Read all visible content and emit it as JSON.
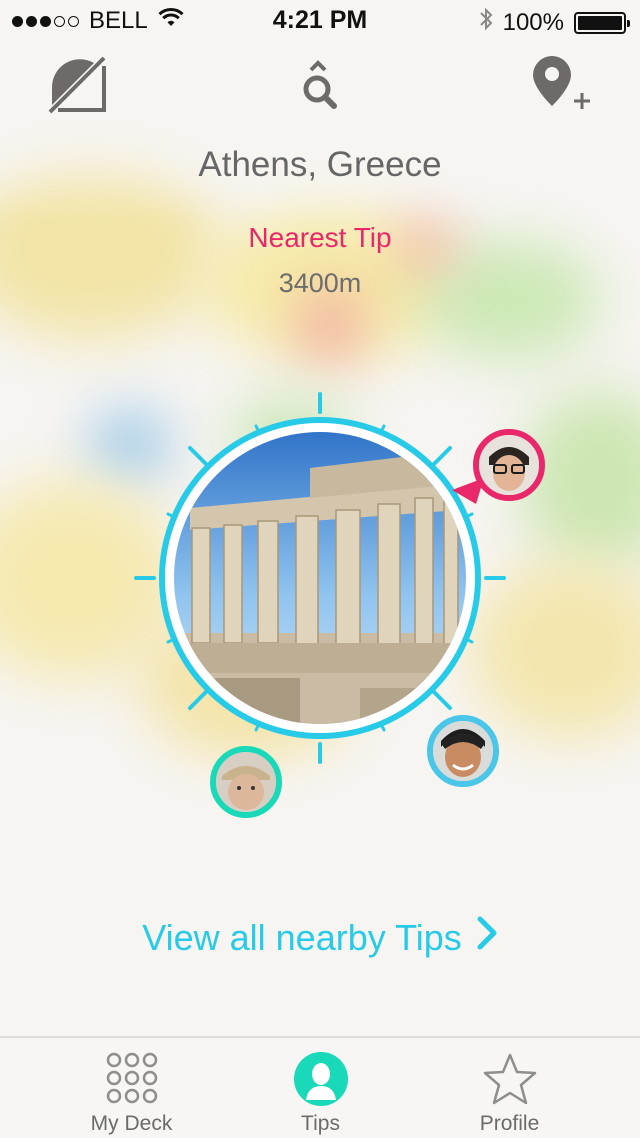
{
  "status_bar": {
    "signal_filled": 3,
    "signal_empty": 2,
    "carrier": "BELL",
    "time": "4:21 PM",
    "battery_percent": "100%",
    "battery_level": 1.0
  },
  "toolbar": {
    "left_icon": "compass-toggle-icon",
    "center_icon": "search-icon",
    "right_icon": "add-location-icon"
  },
  "location": {
    "city": "Athens, Greece"
  },
  "nearest_tip": {
    "label": "Nearest Tip",
    "distance": "3400m"
  },
  "radar": {
    "center_image": "Parthenon photo",
    "colors": {
      "ring": "#27cbe8",
      "pink": "#e8286a",
      "teal": "#1ad9b8",
      "blue": "#4ac6e8"
    },
    "avatars": [
      {
        "name": "avatar-user-glasses",
        "ring_color": "#e8286a"
      },
      {
        "name": "avatar-user-smiling",
        "ring_color": "#4ac6e8"
      },
      {
        "name": "avatar-user-cap",
        "ring_color": "#1ad9b8"
      }
    ]
  },
  "view_all": {
    "label": "View all nearby Tips"
  },
  "tabbar": {
    "tabs": [
      {
        "label": "My Deck",
        "icon": "grid-dots-icon"
      },
      {
        "label": "Tips",
        "icon": "person-icon",
        "active": true
      },
      {
        "label": "Profile",
        "icon": "star-icon"
      }
    ]
  }
}
